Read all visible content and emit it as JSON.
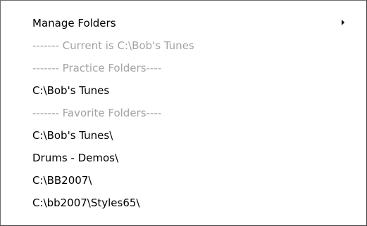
{
  "menu": {
    "items": [
      {
        "label": "Manage Folders",
        "enabled": true,
        "submenu": true,
        "icon": "submenu-arrow-icon"
      },
      {
        "label": "------- Current is C:\\Bob's Tunes",
        "enabled": false
      },
      {
        "label": "------- Practice Folders----",
        "enabled": false
      },
      {
        "label": "C:\\Bob's Tunes",
        "enabled": true
      },
      {
        "label": "------- Favorite Folders----",
        "enabled": false
      },
      {
        "label": "C:\\Bob's Tunes\\",
        "enabled": true
      },
      {
        "label": "Drums - Demos\\",
        "enabled": true
      },
      {
        "label": "C:\\BB2007\\",
        "enabled": true
      },
      {
        "label": "C:\\bb2007\\Styles65\\",
        "enabled": true
      }
    ]
  },
  "colors": {
    "text": "#000000",
    "disabled_text": "#a3a3a3",
    "background": "#ffffff",
    "border": "#6b6b6b"
  }
}
